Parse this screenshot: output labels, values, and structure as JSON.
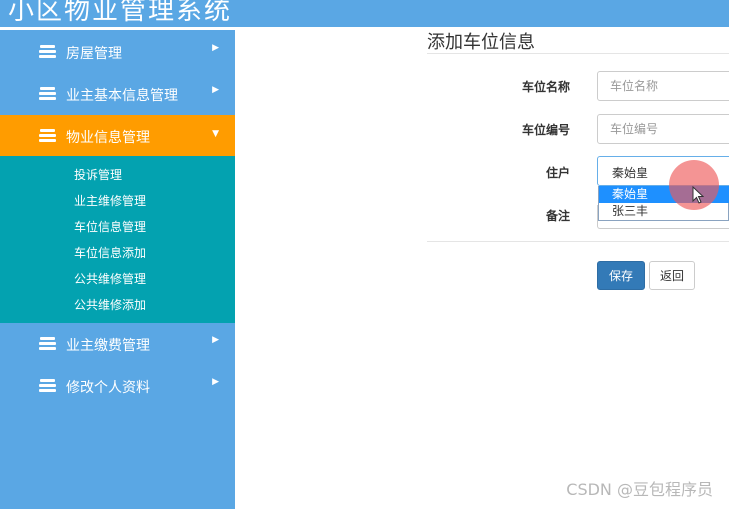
{
  "header": {
    "title": "小区物业管理系统"
  },
  "sidebar": {
    "items": [
      {
        "label": "房屋管理"
      },
      {
        "label": "业主基本信息管理"
      },
      {
        "label": "物业信息管理"
      },
      {
        "label": "业主缴费管理"
      },
      {
        "label": "修改个人资料"
      }
    ],
    "submenu": [
      {
        "label": "投诉管理"
      },
      {
        "label": "业主维修管理"
      },
      {
        "label": "车位信息管理"
      },
      {
        "label": "车位信息添加"
      },
      {
        "label": "公共维修管理"
      },
      {
        "label": "公共维修添加"
      }
    ]
  },
  "form": {
    "title": "添加车位信息",
    "fields": {
      "name_label": "车位名称",
      "name_placeholder": "车位名称",
      "code_label": "车位编号",
      "code_placeholder": "车位编号",
      "resident_label": "住户",
      "resident_value": "秦始皇",
      "remarks_label": "备注"
    },
    "resident_options": [
      "秦始皇",
      "张三丰"
    ],
    "save_label": "保存",
    "back_label": "返回"
  },
  "watermark": "CSDN @豆包程序员",
  "colors": {
    "sidebar": "#5aa7e4",
    "active": "#ff9c00",
    "submenu": "#03a2b0",
    "primary": "#337ab7"
  }
}
